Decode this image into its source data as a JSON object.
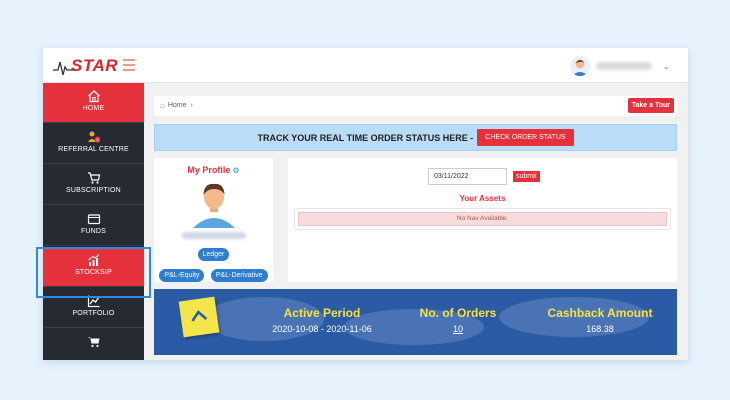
{
  "header": {
    "logo_text": "STAR",
    "user_name": "user name"
  },
  "sidebar": {
    "items": [
      {
        "label": "HOME",
        "icon": "home-icon",
        "active": true
      },
      {
        "label": "REFERRAL CENTRE",
        "icon": "referral-icon",
        "active": false
      },
      {
        "label": "SUBSCRIPTION",
        "icon": "cart-icon",
        "active": false
      },
      {
        "label": "FUNDS",
        "icon": "wallet-icon",
        "active": false
      },
      {
        "label": "STOCKSIP",
        "icon": "growth-chart-icon",
        "active": true
      },
      {
        "label": "PORTFOLIO",
        "icon": "line-chart-icon",
        "active": false
      },
      {
        "label": "",
        "icon": "cart-icon",
        "active": false
      }
    ]
  },
  "breadcrumb": {
    "home_label": "Home",
    "separator": "›"
  },
  "tour_button": "Take a Tour",
  "track": {
    "text": "TRACK YOUR REAL TIME ORDER STATUS HERE -",
    "button": "CHECK ORDER STATUS"
  },
  "profile": {
    "title": "My Profile",
    "name": "user name",
    "buttons": [
      "Ledger",
      "P&L-Equity",
      "P&L-Derivative"
    ]
  },
  "assets": {
    "date_value": "03/11/2022",
    "submit_label": "submit",
    "title": "Your Assets",
    "nav_message": "No Nav Available."
  },
  "stats": {
    "active_period_title": "Active Period",
    "active_period_value": "2020-10-08 - 2020-11-06",
    "orders_title": "No. of Orders",
    "orders_value": "10",
    "cashback_title": "Cashback Amount",
    "cashback_value": "168.38"
  },
  "colors": {
    "accent_red": "#e5313b",
    "sidebar_dark": "#252a33",
    "banner_blue": "#2b5ba5",
    "track_blue": "#b9dcf7",
    "highlight_yellow": "#f7e242",
    "selection_outline": "#2e8ae6"
  }
}
